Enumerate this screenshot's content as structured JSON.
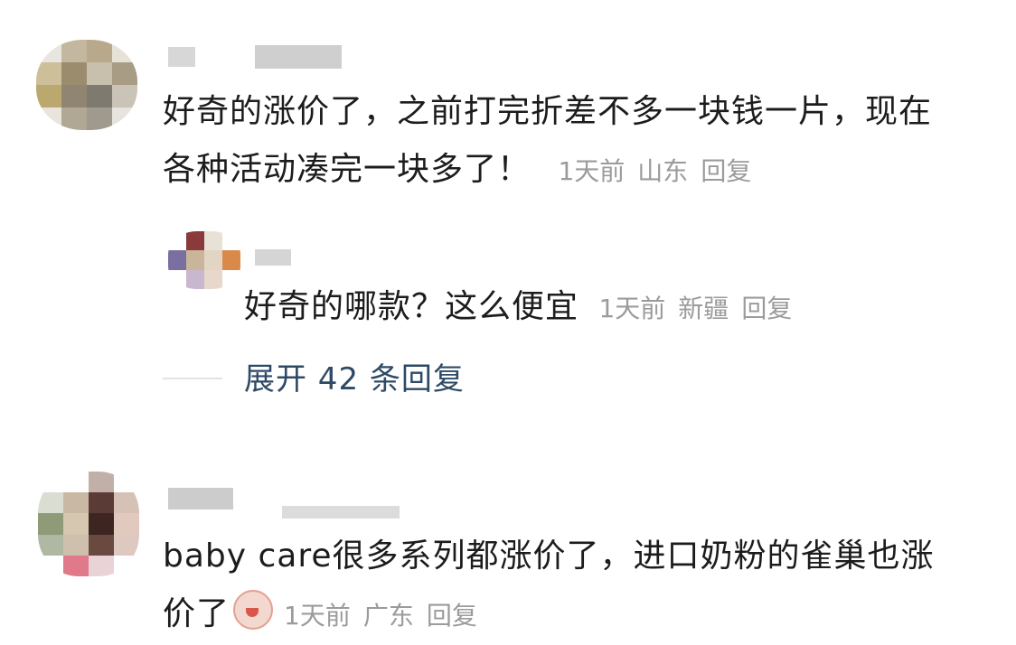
{
  "comments": [
    {
      "text_line1": "好奇的涨价了，之前打完折差不多一块钱一片，现在",
      "text_line2": "各种活动凑完一块多了！",
      "time": "1天前",
      "location": "山东",
      "reply_label": "回复",
      "reply": {
        "text": "好奇的哪款？这么便宜",
        "time": "1天前",
        "location": "新疆",
        "reply_label": "回复"
      },
      "expand_label": "展开 42 条回复"
    },
    {
      "text_line1": "baby care很多系列都涨价了，进口奶粉的雀巢也涨",
      "text_line2": "价了",
      "emoji": "crying-face-icon",
      "time": "1天前",
      "location": "广东",
      "reply_label": "回复"
    }
  ],
  "colors": {
    "text": "#1c1c1c",
    "meta": "#9b9b9b",
    "expand_link": "#2e4a66"
  }
}
